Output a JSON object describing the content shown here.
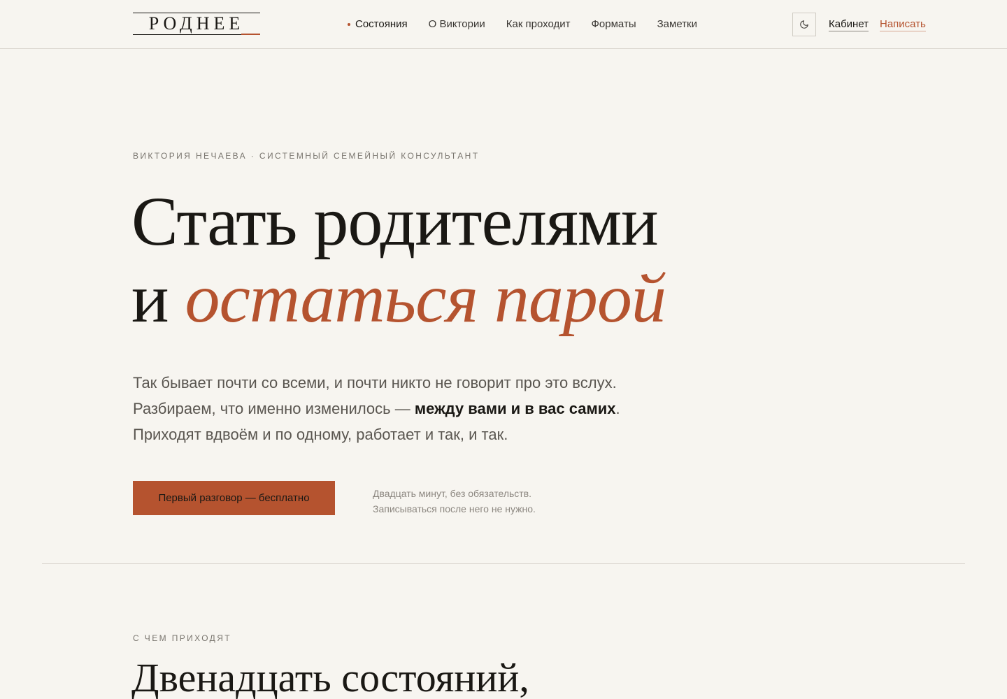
{
  "header": {
    "logo": "РОДНЕЕ",
    "nav": [
      {
        "label": "Состояния",
        "active": true
      },
      {
        "label": "О Виктории",
        "active": false
      },
      {
        "label": "Как проходит",
        "active": false
      },
      {
        "label": "Форматы",
        "active": false
      },
      {
        "label": "Заметки",
        "active": false
      }
    ],
    "theme_toggle_icon": "moon-icon",
    "cabinet_label": "Кабинет",
    "write_label": "Написать"
  },
  "hero": {
    "eyebrow": "ВИКТОРИЯ НЕЧАЕВА · СИСТЕМНЫЙ СЕМЕЙНЫЙ КОНСУЛЬТАНТ",
    "title_line1": "Стать родителями",
    "title_line2_prefix": "и ",
    "title_line2_accent": "остаться парой",
    "lead_part1": "Так бывает почти со всеми, и почти никто не говорит про это вслух. Разбираем, что именно изменилось — ",
    "lead_bold": "между вами и в вас самих",
    "lead_part2": ". Приходят вдвоём и по одному, работает и так, и так.",
    "cta_label": "Первый разговор — бесплатно",
    "cta_note_line1": "Двадцать минут, без обязательств.",
    "cta_note_line2": "Записываться после него не нужно."
  },
  "section": {
    "eyebrow": "С ЧЕМ ПРИХОДЯТ",
    "title": "Двенадцать состояний,"
  },
  "colors": {
    "background": "#f7f5f0",
    "accent": "#b5532f",
    "text": "#1a1814",
    "muted": "#7a766f"
  }
}
